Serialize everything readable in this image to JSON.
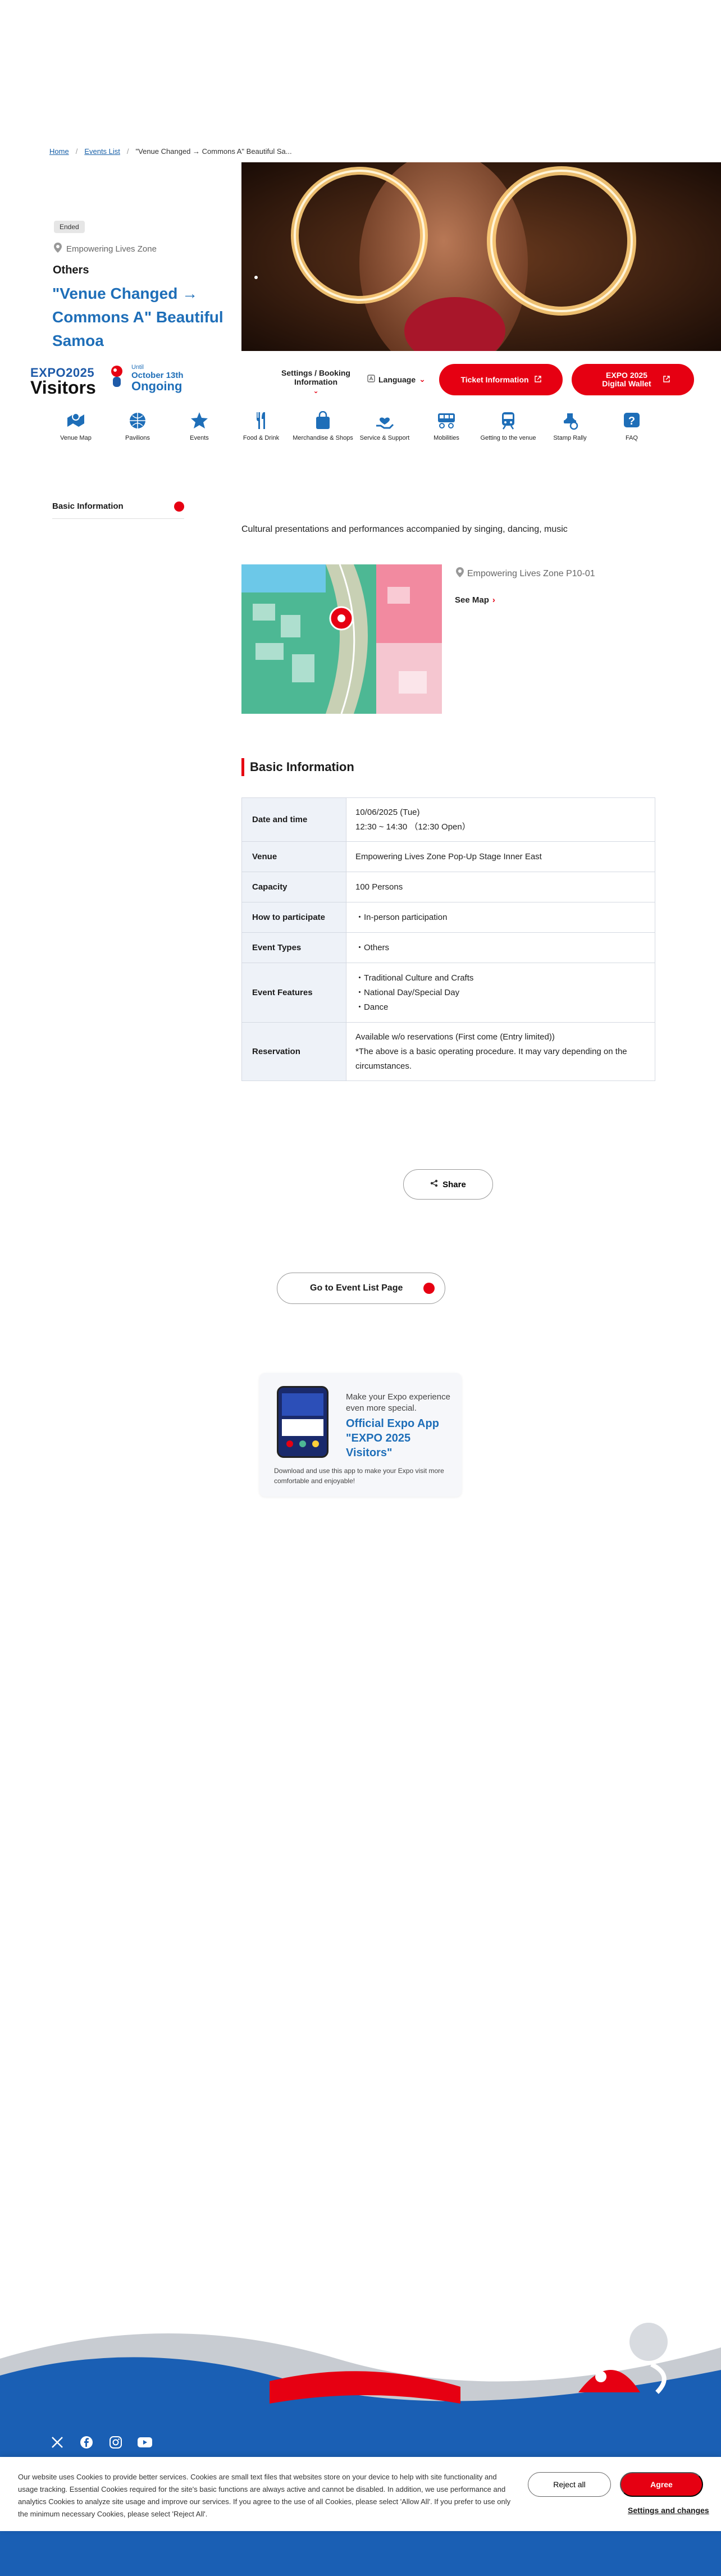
{
  "breadcrumb": {
    "home": "Home",
    "events_list": "Events List",
    "current": "\"Venue Changed → Commons A\" Beautiful Sa..."
  },
  "event": {
    "status_badge": "Ended",
    "zone": "Empowering Lives Zone",
    "category": "Others",
    "title": "\"Venue Changed → Commons A\" Beautiful Samoa",
    "description": "Cultural presentations and performances accompanied by singing, dancing, music"
  },
  "header": {
    "logo_top": "EXPO",
    "logo_year": "2025",
    "logo_bottom": "Visitors",
    "status_label": "Until",
    "status_date": "October 13th",
    "status_state": "Ongoing",
    "settings_label": "Settings / Booking Information",
    "language_label": "Language",
    "ticket_label": "Ticket Information",
    "wallet_label": "EXPO 2025 Digital Wallet"
  },
  "icon_nav": [
    {
      "label": "Venue Map",
      "icon": "venue-map-icon"
    },
    {
      "label": "Pavilions",
      "icon": "pavilion-globe-icon"
    },
    {
      "label": "Events",
      "icon": "events-star-icon"
    },
    {
      "label": "Food & Drink",
      "icon": "fork-knife-icon"
    },
    {
      "label": "Merchandise & Shops",
      "icon": "shopping-bag-icon"
    },
    {
      "label": "Service & Support",
      "icon": "support-hand-icon"
    },
    {
      "label": "Mobilities",
      "icon": "mobility-icon"
    },
    {
      "label": "Getting to the venue",
      "icon": "train-icon"
    },
    {
      "label": "Stamp Rally",
      "icon": "stamp-icon"
    },
    {
      "label": "FAQ",
      "icon": "faq-icon"
    }
  ],
  "sidebar": {
    "basic_info": "Basic Information"
  },
  "map": {
    "location": "Empowering Lives Zone P10-01",
    "see_map": "See Map"
  },
  "basic_info": {
    "heading": "Basic Information",
    "rows": {
      "date": {
        "label": "Date and time",
        "line1": "10/06/2025 (Tue)",
        "line2": "12:30 ~ 14:30 （12:30 Open）"
      },
      "venue": {
        "label": "Venue",
        "value": "Empowering Lives Zone Pop-Up Stage Inner East"
      },
      "capacity": {
        "label": "Capacity",
        "value": "100 Persons"
      },
      "participate": {
        "label": "How to participate",
        "value": "In-person participation"
      },
      "types": {
        "label": "Event Types",
        "value": "Others"
      },
      "features": {
        "label": "Event Features",
        "items": [
          "Traditional Culture and Crafts",
          "National Day/Special Day",
          "Dance"
        ]
      },
      "reservation": {
        "label": "Reservation",
        "line1": "Available w/o reservations (First come (Entry limited))",
        "line2": "*The above is a basic operating procedure. It may vary depending on the circumstances."
      }
    }
  },
  "actions": {
    "share": "Share",
    "event_list": "Go to Event List Page"
  },
  "app_promo": {
    "line1": "Make your Expo experience even more special.",
    "line2": "Official Expo App \"EXPO 2025 Visitors\"",
    "line3": "Download and use this app to make your Expo visit more comfortable and enjoyable!"
  },
  "cookie": {
    "text": "Our website uses Cookies to provide better services. Cookies are small text files that websites store on your device to help with site functionality and usage tracking. Essential Cookies required for the site's basic functions are always active and cannot be disabled. In addition, we use performance and analytics Cookies to analyze site usage and improve our services. If you agree to the use of all Cookies, please select 'Allow All'. If you prefer to use only the minimum necessary Cookies, please select 'Reject All'.",
    "reject": "Reject all",
    "agree": "Agree",
    "settings": "Settings and changes"
  },
  "colors": {
    "accent_red": "#e60012",
    "brand_blue": "#1e6eb8",
    "footer_blue": "#1a5fb4"
  }
}
